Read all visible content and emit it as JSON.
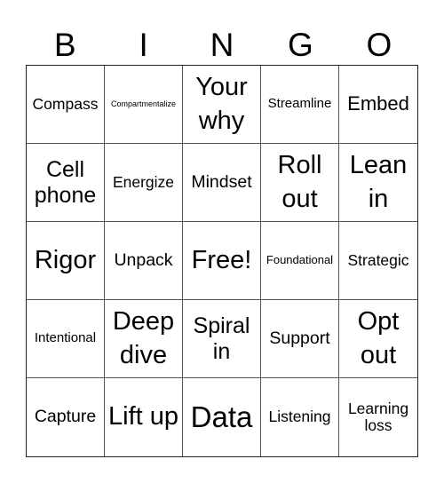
{
  "header": {
    "letters": [
      "B",
      "I",
      "N",
      "G",
      "O"
    ]
  },
  "cells": [
    "Compass",
    "Compartmentalize",
    "Your why",
    "Streamline",
    "Embed",
    "Cell phone",
    "Energize",
    "Mindset",
    "Roll out",
    "Lean in",
    "Rigor",
    "Unpack",
    "Free!",
    "Foundational",
    "Strategic",
    "Intentional",
    "Deep dive",
    "Spiral in",
    "Support",
    "Opt out",
    "Capture",
    "Lift up",
    "Data",
    "Listening",
    "Learning loss"
  ]
}
